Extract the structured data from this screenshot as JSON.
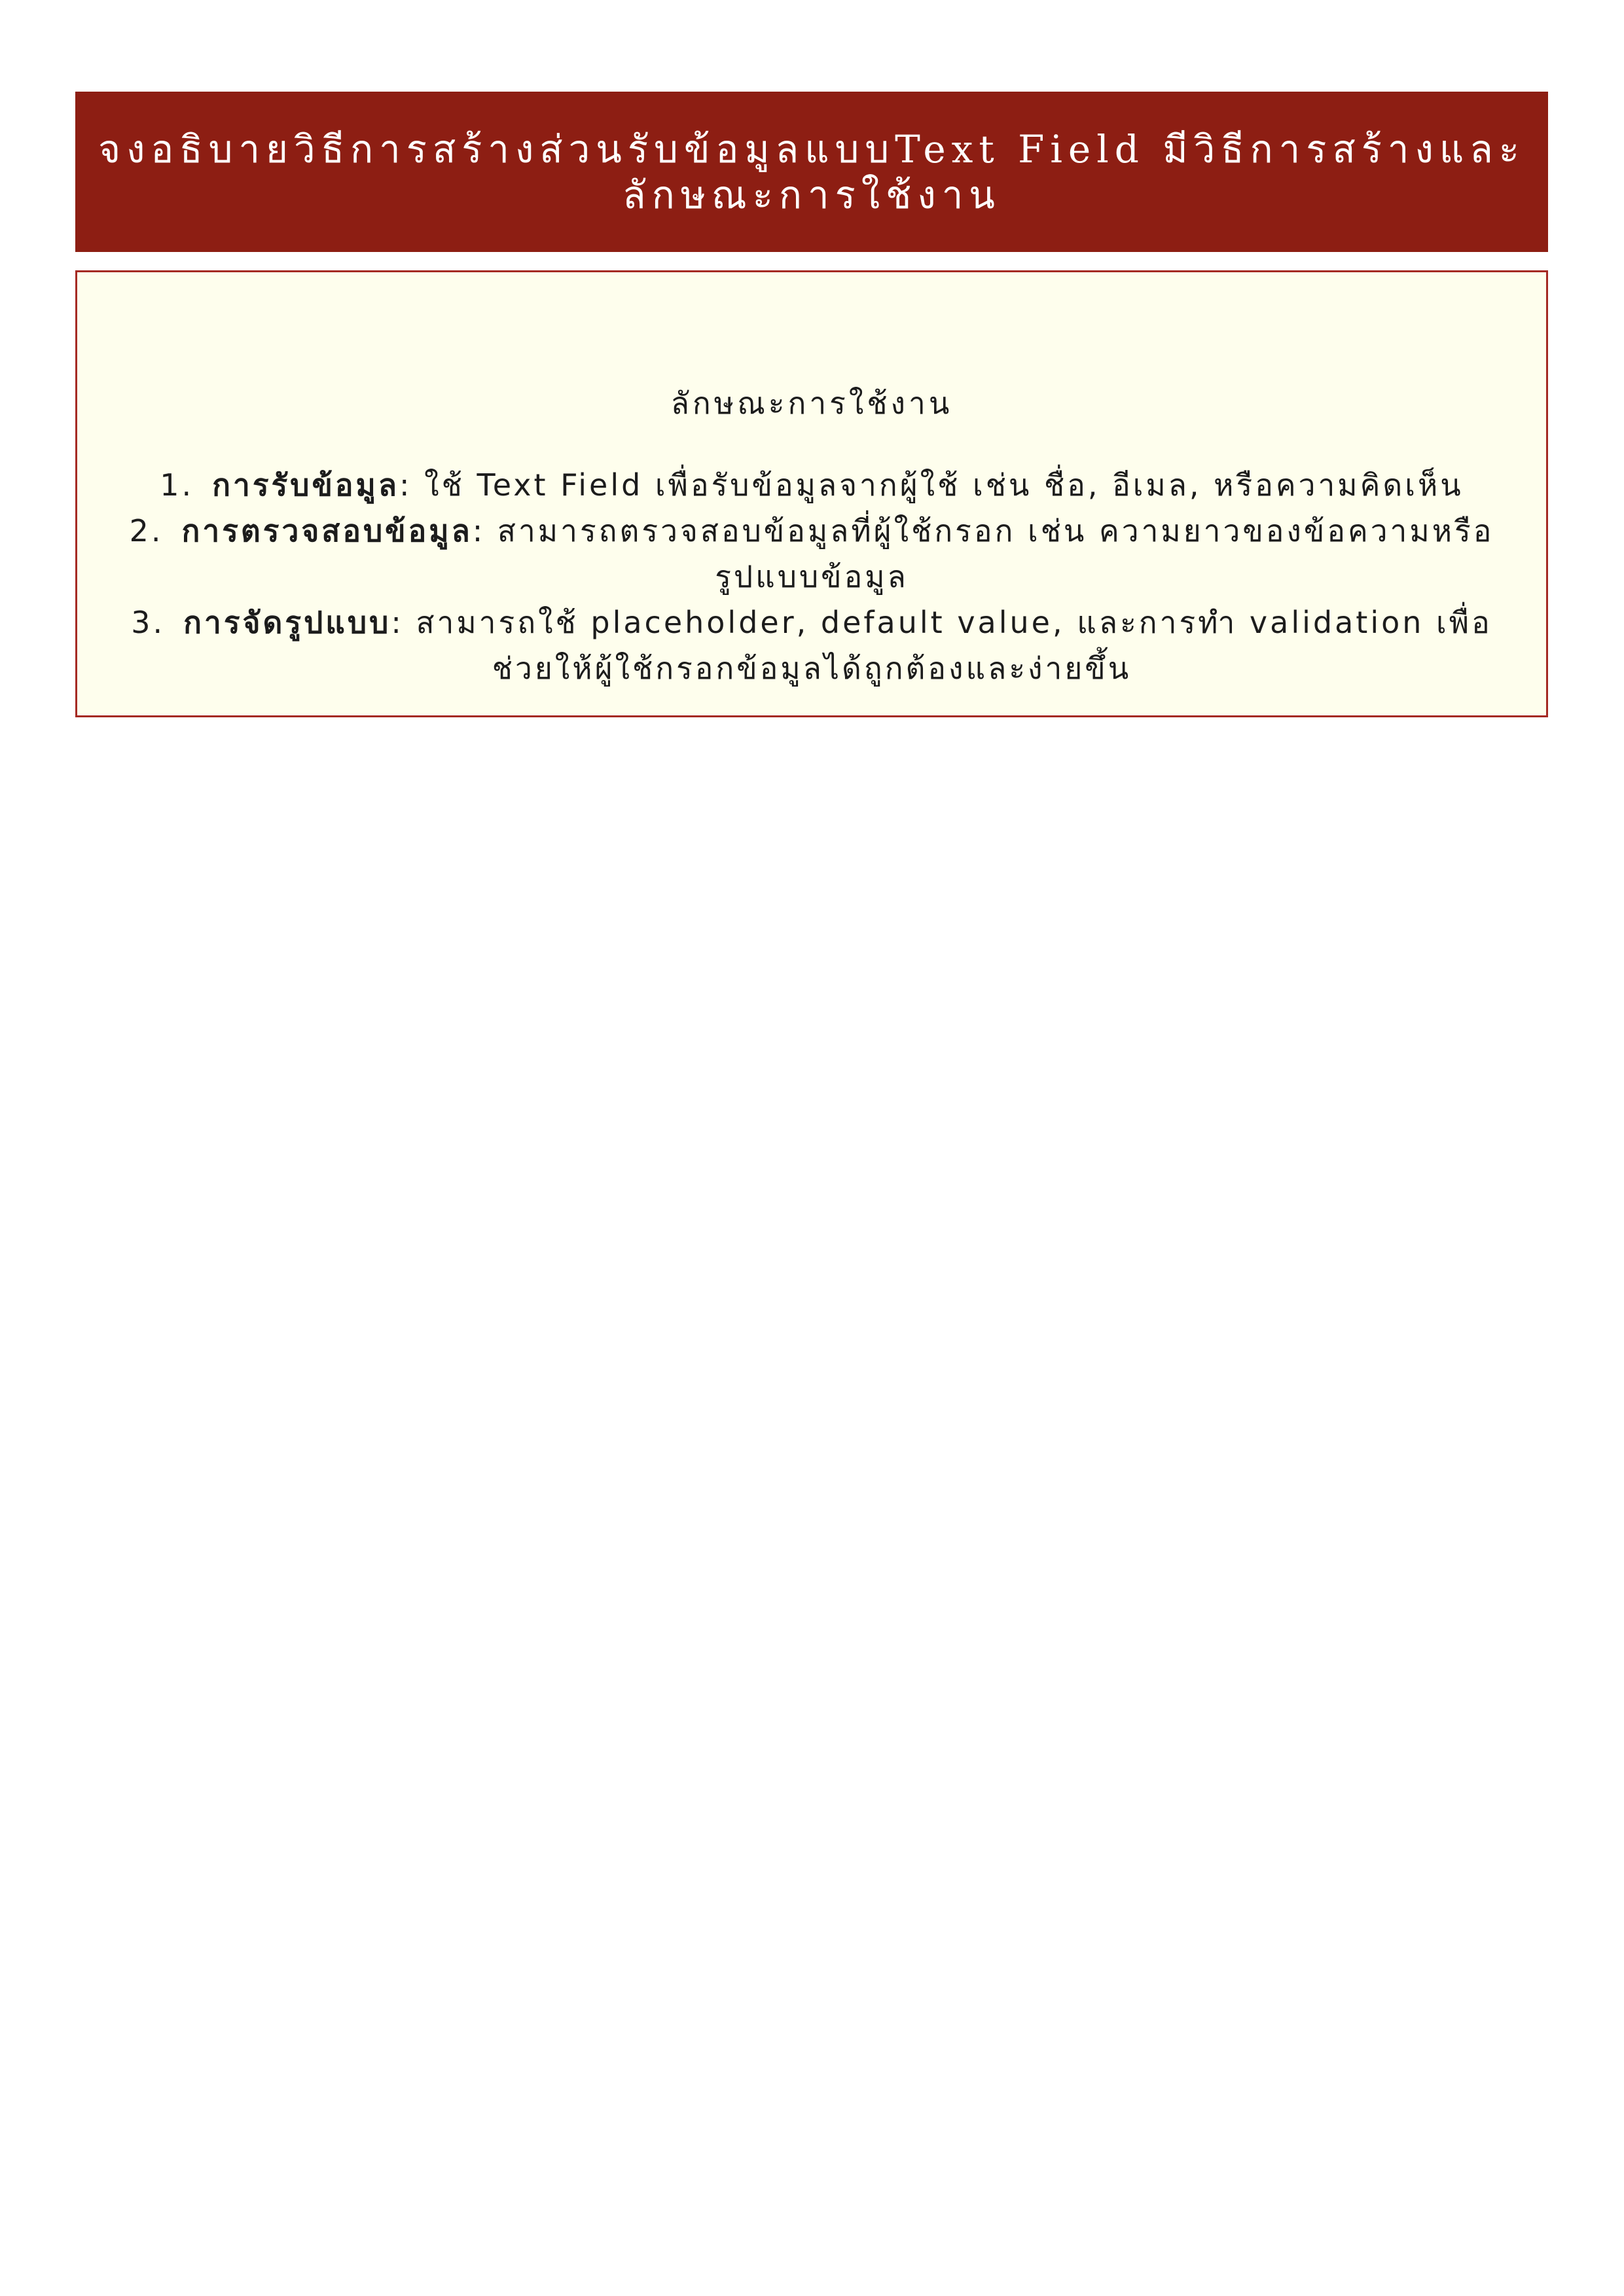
{
  "title": {
    "line1": "จงอธิบายวิธีการสร้างส่วนรับข้อมูลแบบText Field มีวิธีการสร้างและ",
    "line2": "ลักษณะการใช้งาน"
  },
  "section_heading": "ลักษณะการใช้งาน",
  "items": [
    {
      "number": "1.",
      "term": "การรับข้อมูล",
      "line1": ": ใช้ Text Field เพื่อรับข้อมูลจากผู้ใช้ เช่น ชื่อ, อีเมล, หรือความคิดเห็น",
      "line2": ""
    },
    {
      "number": "2.",
      "term": "การตรวจสอบข้อมูล",
      "line1": ": สามารถตรวจสอบข้อมูลที่ผู้ใช้กรอก เช่น ความยาวของข้อความหรือ",
      "line2": "รูปแบบข้อมูล"
    },
    {
      "number": "3.",
      "term": "การจัดรูปแบบ",
      "line1": ": สามารถใช้ placeholder, default value, และการทำ validation เพื่อ",
      "line2": "ช่วยให้ผู้ใช้กรอกข้อมูลได้ถูกต้องและง่ายขึ้น"
    }
  ],
  "colors": {
    "banner": "#8d1e13",
    "box_background": "#fefeed",
    "box_border": "#a52a23"
  }
}
